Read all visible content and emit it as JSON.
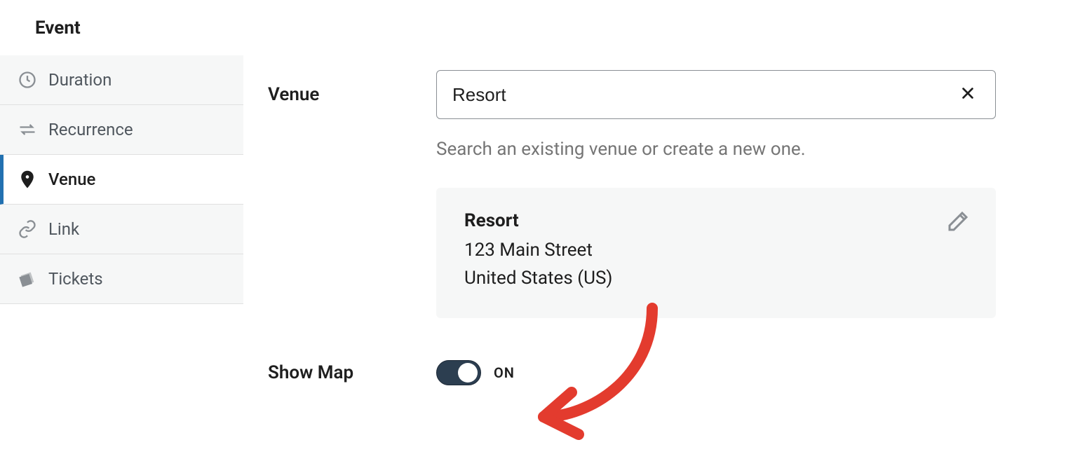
{
  "sidebar": {
    "title": "Event",
    "items": [
      {
        "label": "Duration",
        "icon": "clock-icon"
      },
      {
        "label": "Recurrence",
        "icon": "repeat-icon"
      },
      {
        "label": "Venue",
        "icon": "pin-icon",
        "active": true
      },
      {
        "label": "Link",
        "icon": "link-icon"
      },
      {
        "label": "Tickets",
        "icon": "ticket-icon"
      }
    ]
  },
  "venue": {
    "field_label": "Venue",
    "input_value": "Resort",
    "help_text": "Search an existing venue or create a new one.",
    "card": {
      "name": "Resort",
      "address": "123 Main Street",
      "country": "United States (US)"
    }
  },
  "showmap": {
    "field_label": "Show Map",
    "toggle_state": "ON"
  }
}
